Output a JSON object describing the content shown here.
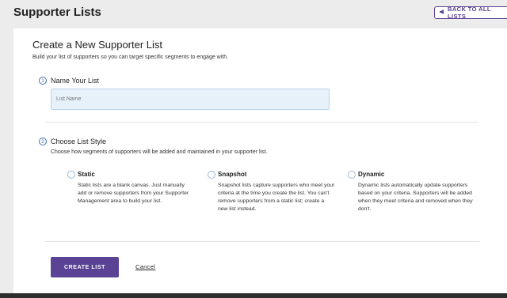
{
  "header": {
    "title": "Supporter Lists",
    "back_label": "BACK TO ALL LISTS",
    "back_icon": "megaphone-icon"
  },
  "form": {
    "title": "Create a New Supporter List",
    "subtitle": "Build your list of supporters so you can target specific segments to engage with.",
    "step1": {
      "number": "1",
      "title": "Name Your List",
      "input_placeholder": "List Name",
      "input_value": ""
    },
    "step2": {
      "number": "2",
      "title": "Choose List Style",
      "subtitle": "Choose how segments of supporters will be added and maintained in your supporter list.",
      "options": [
        {
          "title": "Static",
          "description": "Static lists are a blank canvas. Just manually add or remove supporters from your Supporter Management area to build your list.",
          "selected": false
        },
        {
          "title": "Snapshot",
          "description": "Snapshot lists capture supporters who meet your criteria at the time you create the list. You can't remove supporters from a static list; create a new list instead.",
          "selected": false
        },
        {
          "title": "Dynamic",
          "description": "Dynamic lists automatically update supporters based on your criteria. Supporters will be added when they meet criteria and removed when they don't.",
          "selected": false
        }
      ]
    },
    "actions": {
      "create_label": "CREATE LIST",
      "cancel_label": "Cancel"
    }
  },
  "colors": {
    "accent": "#5a4394",
    "input_bg": "#e6f1fa",
    "step_blue": "#3d6fb0",
    "page_bg": "#ececec"
  }
}
